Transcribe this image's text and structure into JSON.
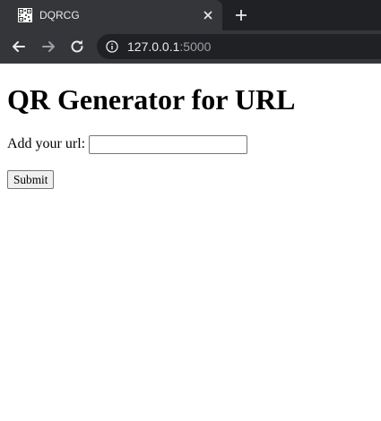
{
  "browser": {
    "tab": {
      "title": "DQRCG",
      "favicon": "qr-code-icon",
      "close_icon": "close-icon"
    },
    "new_tab_icon": "plus-icon",
    "nav": {
      "back_icon": "arrow-left-icon",
      "forward_icon": "arrow-right-icon",
      "reload_icon": "reload-icon"
    },
    "address_bar": {
      "security_icon": "info-icon",
      "host": "127.0.0.1",
      "port": ":5000"
    },
    "colors": {
      "tabstrip_bg": "#202124",
      "toolbar_bg": "#35363a",
      "omnibox_bg": "#202124",
      "text": "#e8eaed",
      "muted_text": "#9aa0a6"
    }
  },
  "page": {
    "title": "QR Generator for URL",
    "form": {
      "url_label": "Add your url:",
      "url_value": "",
      "submit_label": "Submit"
    }
  }
}
